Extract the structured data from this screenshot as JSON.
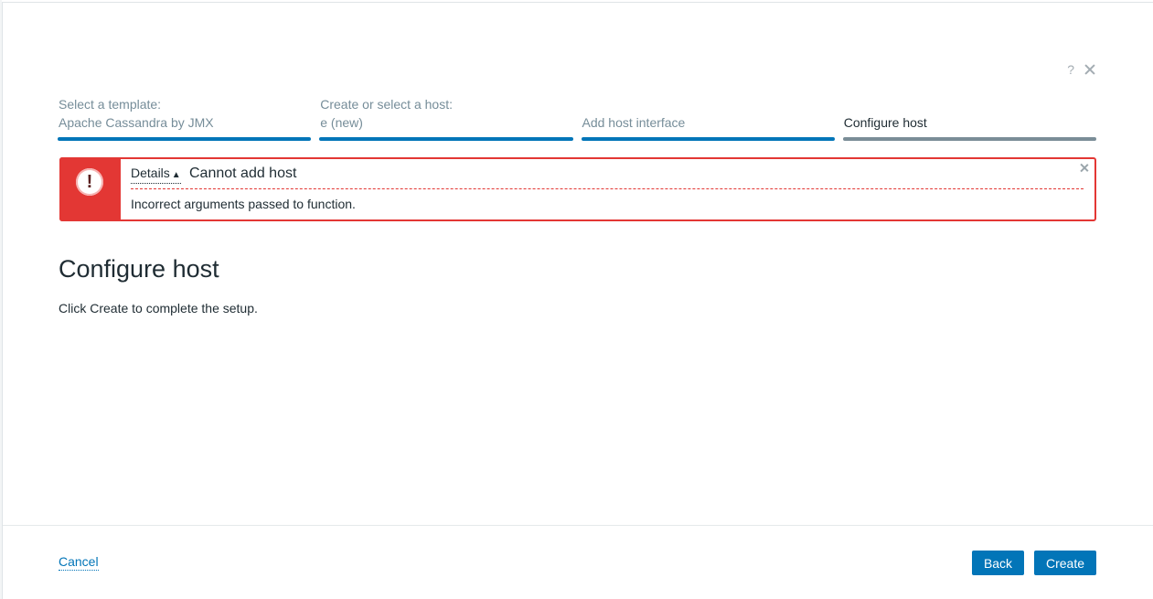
{
  "header": {
    "help_icon": "?",
    "help_icon_name": "help-icon",
    "close_icon_name": "close-icon"
  },
  "steps": [
    {
      "label": "Select a template:",
      "value": "Apache Cassandra by JMX",
      "state": "done"
    },
    {
      "label": "Create or select a host:",
      "value": "e (new)",
      "state": "done"
    },
    {
      "label": "",
      "value": "Add host interface",
      "state": "done"
    },
    {
      "label": "",
      "value": "Configure host",
      "state": "current"
    }
  ],
  "alert": {
    "details_label": "Details",
    "caret": "▲",
    "title": "Cannot add host",
    "message": "Incorrect arguments passed to function.",
    "icon_glyph": "!",
    "color": "#e33734"
  },
  "main": {
    "title": "Configure host",
    "text": "Click Create to complete the setup."
  },
  "footer": {
    "cancel_label": "Cancel",
    "back_label": "Back",
    "create_label": "Create"
  },
  "colors": {
    "accent": "#0275b8",
    "step_current_bar": "#7a8d97",
    "error": "#e33734"
  }
}
